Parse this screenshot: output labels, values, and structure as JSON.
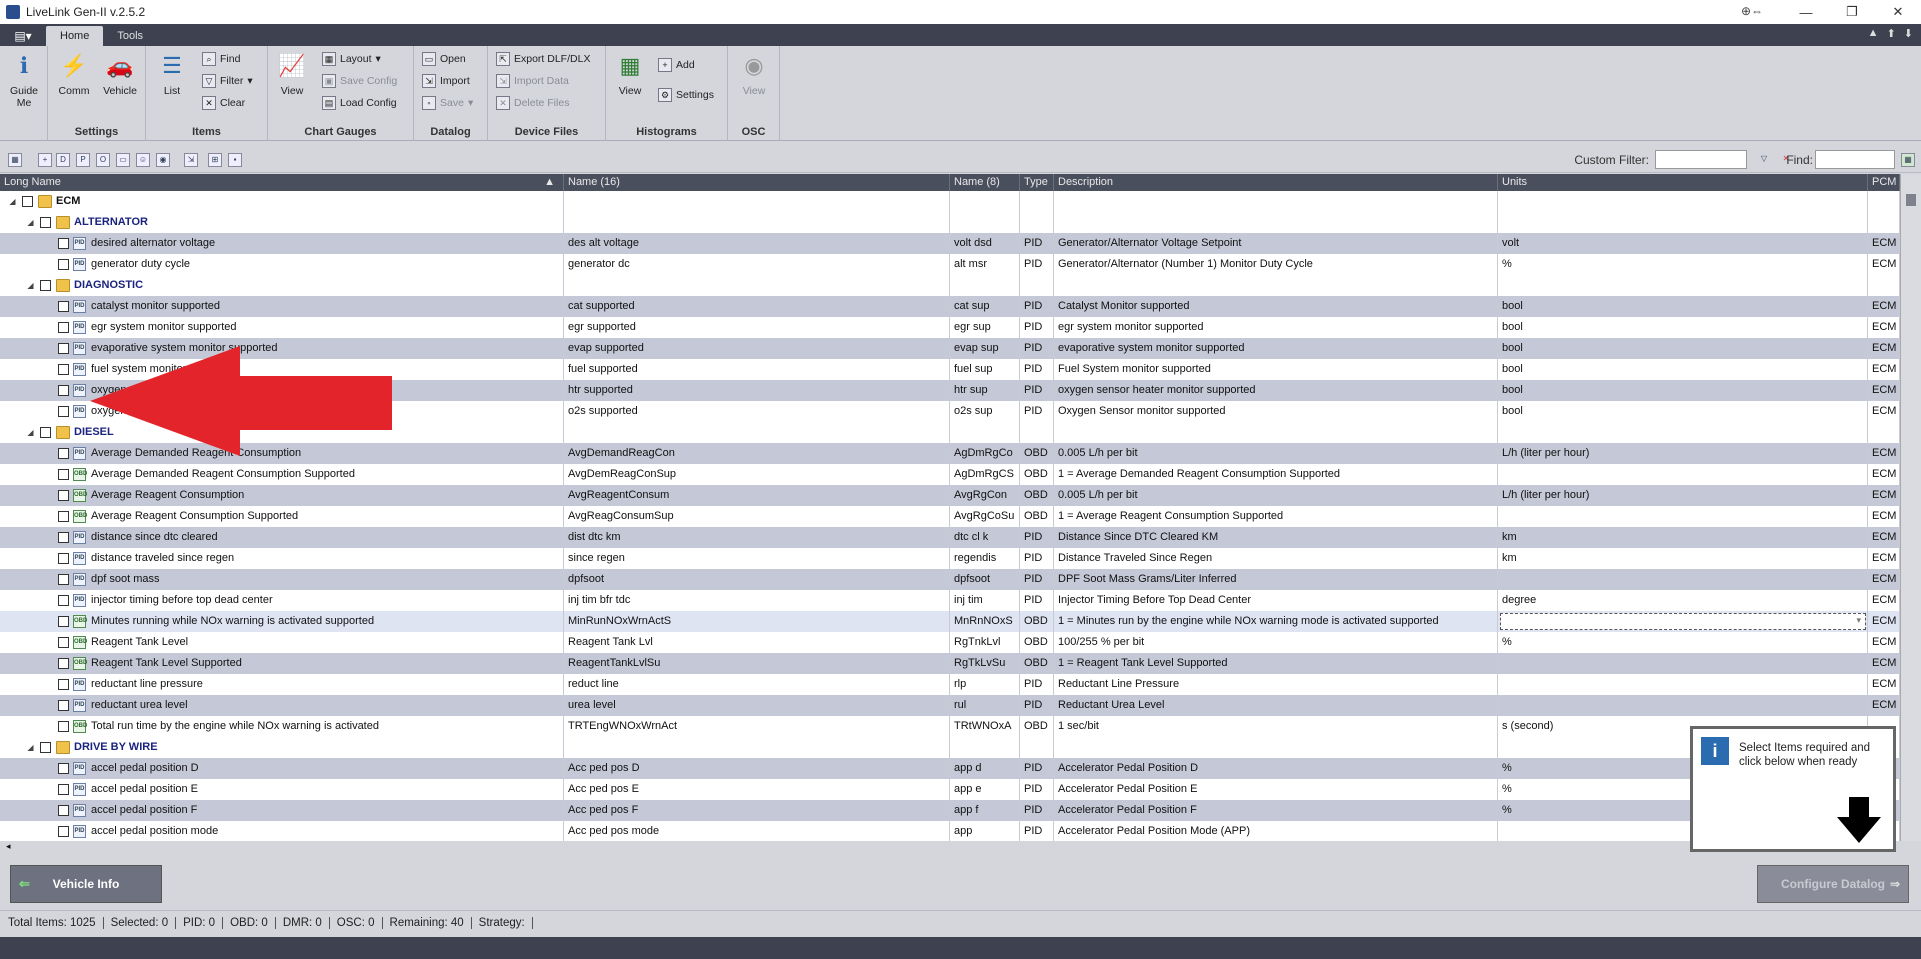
{
  "window": {
    "title": "LiveLink Gen-II  v.2.5.2",
    "min": "—",
    "max": "❐",
    "close": "✕",
    "extra": "⊕⇔"
  },
  "menu": {
    "tabs": [
      "Home",
      "Tools"
    ]
  },
  "ribbon": {
    "guide": "Guide Me",
    "comm": "Comm",
    "vehicle": "Vehicle",
    "settings_group": "Settings",
    "list": "List",
    "find": "Find",
    "filter": "Filter",
    "clear": "Clear",
    "items_group": "Items",
    "chart_view": "View",
    "layout": "Layout",
    "save_config": "Save Config",
    "load_config": "Load Config",
    "chart_group": "Chart  Gauges",
    "open": "Open",
    "import": "Import",
    "save": "Save",
    "datalog_group": "Datalog",
    "export": "Export DLF/DLX",
    "import_data": "Import Data",
    "delete_files": "Delete Files",
    "device_group": "Device Files",
    "hist_view": "View",
    "add": "Add",
    "hist_settings": "Settings",
    "hist_group": "Histograms",
    "osc_view": "View",
    "osc_group": "OSC"
  },
  "toolbar": {
    "custom_filter": "Custom Filter:",
    "find": "Find:"
  },
  "columns": {
    "long": "Long Name",
    "name16": "Name (16)",
    "name8": "Name (8)",
    "type": "Type",
    "desc": "Description",
    "units": "Units",
    "pcm": "PCM"
  },
  "rows": [
    {
      "kind": "root",
      "long": "ECM"
    },
    {
      "kind": "group",
      "long": "ALTERNATOR"
    },
    {
      "kind": "item",
      "icon": "pid",
      "long": "desired alternator voltage",
      "n16": "des alt voltage",
      "n8": "volt dsd",
      "type": "PID",
      "desc": "Generator/Alternator Voltage Setpoint",
      "units": "volt",
      "pcm": "ECM"
    },
    {
      "kind": "item",
      "icon": "pid",
      "long": "generator duty cycle",
      "n16": "generator dc",
      "n8": "alt msr",
      "type": "PID",
      "desc": "Generator/Alternator (Number 1) Monitor Duty Cycle",
      "units": "%",
      "pcm": "ECM"
    },
    {
      "kind": "group",
      "long": "DIAGNOSTIC"
    },
    {
      "kind": "item",
      "icon": "pid",
      "long": "catalyst monitor supported",
      "n16": "cat supported",
      "n8": "cat sup",
      "type": "PID",
      "desc": "Catalyst Monitor supported",
      "units": "bool",
      "pcm": "ECM"
    },
    {
      "kind": "item",
      "icon": "pid",
      "long": "egr system monitor supported",
      "n16": "egr supported",
      "n8": "egr sup",
      "type": "PID",
      "desc": "egr system monitor supported",
      "units": "bool",
      "pcm": "ECM"
    },
    {
      "kind": "item",
      "icon": "pid",
      "long": "evaporative system monitor supported",
      "n16": "evap supported",
      "n8": "evap sup",
      "type": "PID",
      "desc": "evaporative system monitor supported",
      "units": "bool",
      "pcm": "ECM"
    },
    {
      "kind": "item",
      "icon": "pid",
      "long": "fuel system monitor supported",
      "n16": "fuel supported",
      "n8": "fuel sup",
      "type": "PID",
      "desc": "Fuel System monitor supported",
      "units": "bool",
      "pcm": "ECM"
    },
    {
      "kind": "item",
      "icon": "pid",
      "long": "oxygen sensor heater monitor supported",
      "n16": "htr supported",
      "n8": "htr sup",
      "type": "PID",
      "desc": "oxygen sensor heater monitor supported",
      "units": "bool",
      "pcm": "ECM"
    },
    {
      "kind": "item",
      "icon": "pid",
      "long": "oxygen sensor monitor supported",
      "n16": "o2s supported",
      "n8": "o2s sup",
      "type": "PID",
      "desc": "Oxygen Sensor monitor supported",
      "units": "bool",
      "pcm": "ECM"
    },
    {
      "kind": "group",
      "long": "DIESEL"
    },
    {
      "kind": "item",
      "icon": "pid",
      "long": "Average Demanded Reagent Consumption",
      "n16": "AvgDemandReagCon",
      "n8": "AgDmRgCo",
      "type": "OBD",
      "desc": "0.005 L/h per bit",
      "units": "L/h (liter per hour)",
      "pcm": "ECM"
    },
    {
      "kind": "item",
      "icon": "obd",
      "long": "Average Demanded Reagent Consumption Supported",
      "n16": "AvgDemReagConSup",
      "n8": "AgDmRgCS",
      "type": "OBD",
      "desc": "1 = Average Demanded Reagent Consumption Supported",
      "units": "",
      "pcm": "ECM"
    },
    {
      "kind": "item",
      "icon": "obd",
      "long": "Average Reagent Consumption",
      "n16": "AvgReagentConsum",
      "n8": "AvgRgCon",
      "type": "OBD",
      "desc": "0.005 L/h per bit",
      "units": "L/h (liter per hour)",
      "pcm": "ECM"
    },
    {
      "kind": "item",
      "icon": "obd",
      "long": "Average Reagent Consumption Supported",
      "n16": "AvgReagConsumSup",
      "n8": "AvgRgCoSu",
      "type": "OBD",
      "desc": "1 = Average Reagent Consumption Supported",
      "units": "",
      "pcm": "ECM"
    },
    {
      "kind": "item",
      "icon": "pid",
      "long": "distance since dtc cleared",
      "n16": "dist dtc km",
      "n8": "dtc cl k",
      "type": "PID",
      "desc": "Distance Since DTC Cleared KM",
      "units": "km",
      "pcm": "ECM"
    },
    {
      "kind": "item",
      "icon": "pid",
      "long": "distance traveled since regen",
      "n16": "since regen",
      "n8": "regendis",
      "type": "PID",
      "desc": "Distance Traveled Since Regen",
      "units": "km",
      "pcm": "ECM"
    },
    {
      "kind": "item",
      "icon": "pid",
      "long": "dpf soot mass",
      "n16": "dpfsoot",
      "n8": "dpfsoot",
      "type": "PID",
      "desc": "DPF Soot Mass Grams/Liter Inferred",
      "units": "",
      "pcm": "ECM"
    },
    {
      "kind": "item",
      "icon": "pid",
      "long": "injector timing before top dead center",
      "n16": "inj tim bfr tdc",
      "n8": "inj tim",
      "type": "PID",
      "desc": "Injector Timing Before Top Dead Center",
      "units": "degree",
      "pcm": "ECM"
    },
    {
      "kind": "sel",
      "icon": "obd",
      "long": "Minutes running while NOx warning is activated supported",
      "n16": "MinRunNOxWrnActS",
      "n8": "MnRnNOxS",
      "type": "OBD",
      "desc": "1 = Minutes run by the engine while NOx warning mode is activated supported",
      "units": "",
      "pcm": "ECM"
    },
    {
      "kind": "item",
      "icon": "obd",
      "long": "Reagent Tank Level",
      "n16": "Reagent Tank Lvl",
      "n8": "RgTnkLvl",
      "type": "OBD",
      "desc": "100/255 % per bit",
      "units": "%",
      "pcm": "ECM"
    },
    {
      "kind": "item",
      "icon": "obd",
      "long": "Reagent Tank Level Supported",
      "n16": "ReagentTankLvlSu",
      "n8": "RgTkLvSu",
      "type": "OBD",
      "desc": "1 = Reagent Tank Level Supported",
      "units": "",
      "pcm": "ECM"
    },
    {
      "kind": "item",
      "icon": "pid",
      "long": "reductant line pressure",
      "n16": "reduct line",
      "n8": "rlp",
      "type": "PID",
      "desc": "Reductant Line Pressure",
      "units": "",
      "pcm": "ECM"
    },
    {
      "kind": "item",
      "icon": "pid",
      "long": "reductant urea level",
      "n16": "urea level",
      "n8": "rul",
      "type": "PID",
      "desc": "Reductant Urea Level",
      "units": "",
      "pcm": "ECM"
    },
    {
      "kind": "item",
      "icon": "obd",
      "long": "Total run time by the engine while NOx warning is activated",
      "n16": "TRTEngWNOxWrnAct",
      "n8": "TRtWNOxA",
      "type": "OBD",
      "desc": "1 sec/bit",
      "units": "s (second)",
      "pcm": ""
    },
    {
      "kind": "group",
      "long": "DRIVE BY WIRE"
    },
    {
      "kind": "item",
      "icon": "pid",
      "long": "accel pedal position D",
      "n16": "Acc ped pos D",
      "n8": "app d",
      "type": "PID",
      "desc": "Accelerator Pedal Position D",
      "units": "%",
      "pcm": ""
    },
    {
      "kind": "item",
      "icon": "pid",
      "long": "accel pedal position E",
      "n16": "Acc ped pos E",
      "n8": "app e",
      "type": "PID",
      "desc": "Accelerator Pedal Position E",
      "units": "%",
      "pcm": ""
    },
    {
      "kind": "item",
      "icon": "pid",
      "long": "accel pedal position F",
      "n16": "Acc ped pos F",
      "n8": "app f",
      "type": "PID",
      "desc": "Accelerator Pedal Position F",
      "units": "%",
      "pcm": ""
    },
    {
      "kind": "item",
      "icon": "pid",
      "long": "accel pedal position mode",
      "n16": "Acc ped pos mode",
      "n8": "app",
      "type": "PID",
      "desc": "Accelerator Pedal Position Mode (APP)",
      "units": "",
      "pcm": ""
    }
  ],
  "popup": {
    "text": "Select Items required and click below when ready"
  },
  "buttons": {
    "vehicle_info": "Vehicle Info",
    "configure": "Configure Datalog"
  },
  "status": {
    "total": "Total Items: 1025",
    "selected": "Selected: 0",
    "pid": "PID: 0",
    "obd": "OBD: 0",
    "dmr": "DMR: 0",
    "osc": "OSC: 0",
    "remaining": "Remaining: 40",
    "strategy": "Strategy:"
  }
}
